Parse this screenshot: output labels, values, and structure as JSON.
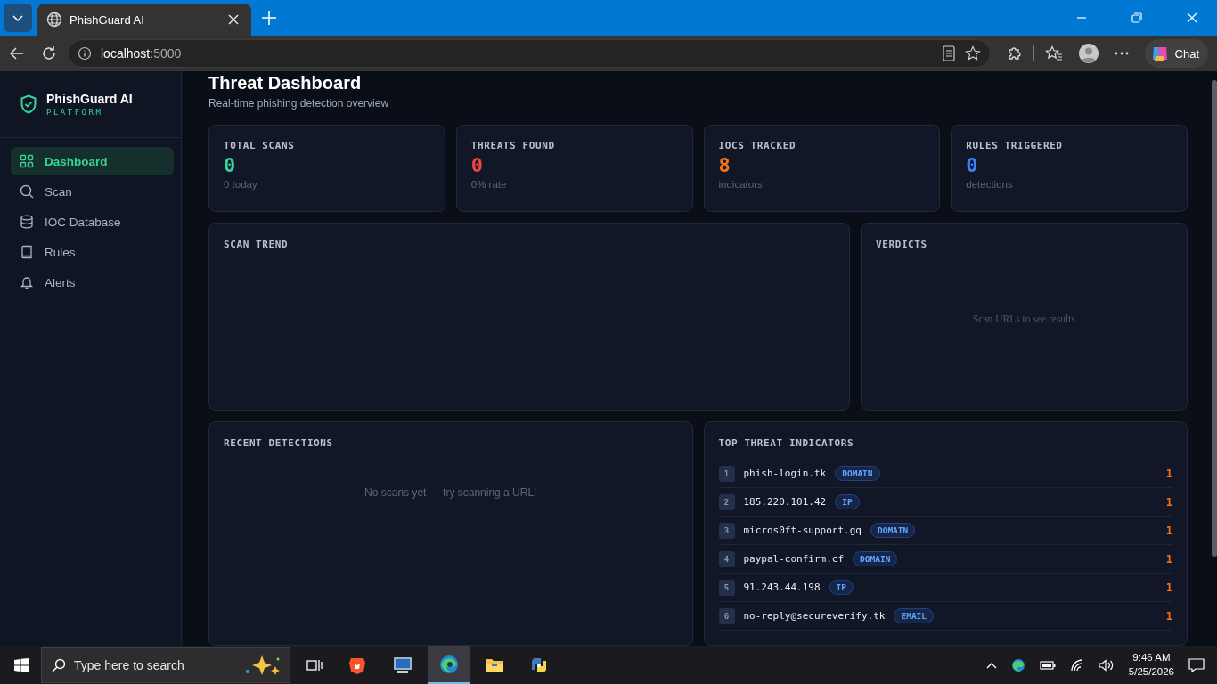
{
  "browser": {
    "tabs": [
      {
        "title": "PhishGuard AI",
        "selected": true
      }
    ],
    "address": {
      "host": "localhost",
      "port": ":5000"
    },
    "chat": "Chat"
  },
  "sidebar": {
    "brand": {
      "name": "PhishGuard AI",
      "tagline": "PLATFORM"
    },
    "nav": [
      {
        "label": "Dashboard",
        "selected": true
      },
      {
        "label": "Scan",
        "selected": false
      },
      {
        "label": "IOC Database",
        "selected": false
      },
      {
        "label": "Rules",
        "selected": false
      },
      {
        "label": "Alerts",
        "selected": false
      }
    ]
  },
  "header": {
    "title": "Threat Dashboard",
    "subtitle": "Real-time phishing detection overview"
  },
  "stats": [
    {
      "label": "TOTAL SCANS",
      "value": "0",
      "note": "0 today",
      "color": "#34d399"
    },
    {
      "label": "THREATS FOUND",
      "value": "0",
      "note": "0% rate",
      "color": "#ef4444"
    },
    {
      "label": "IOCS TRACKED",
      "value": "8",
      "note": "indicators",
      "color": "#f97316"
    },
    {
      "label": "RULES TRIGGERED",
      "value": "0",
      "note": "detections",
      "color": "#3b82f6"
    }
  ],
  "scan_trend": {
    "title": "SCAN TREND"
  },
  "verdicts": {
    "title": "VERDICTS",
    "empty": "Scan URLs to see results"
  },
  "recent": {
    "title": "RECENT DETECTIONS",
    "empty": "No scans yet — try scanning a URL!"
  },
  "indicators": {
    "title": "TOP THREAT INDICATORS",
    "items": [
      {
        "rank": "1",
        "value": "phish-login.tk",
        "type": "DOMAIN",
        "count": "1"
      },
      {
        "rank": "2",
        "value": "185.220.101.42",
        "type": "IP",
        "count": "1"
      },
      {
        "rank": "3",
        "value": "micros0ft-support.gq",
        "type": "DOMAIN",
        "count": "1"
      },
      {
        "rank": "4",
        "value": "paypal-confirm.cf",
        "type": "DOMAIN",
        "count": "1"
      },
      {
        "rank": "5",
        "value": "91.243.44.198",
        "type": "IP",
        "count": "1"
      },
      {
        "rank": "6",
        "value": "no-reply@secureverify.tk",
        "type": "EMAIL",
        "count": "1"
      }
    ]
  },
  "taskbar": {
    "search_placeholder": "Type here to search",
    "time": "9:46 AM",
    "date": "5/25/2026"
  }
}
